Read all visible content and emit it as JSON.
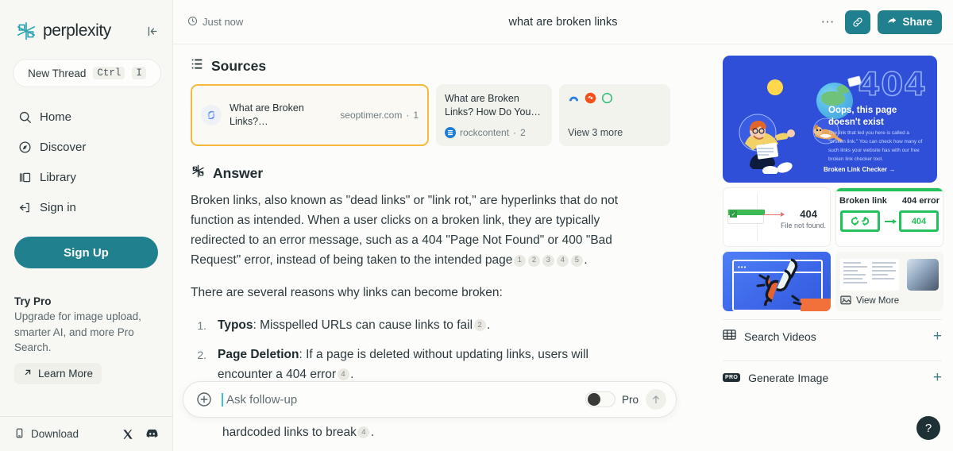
{
  "sidebar": {
    "brand": "perplexity",
    "collapse_icon": "collapse-sidebar-icon",
    "new_thread": {
      "label": "New Thread",
      "key1": "Ctrl",
      "key2": "I"
    },
    "nav": [
      {
        "label": "Home",
        "icon": "search-icon"
      },
      {
        "label": "Discover",
        "icon": "compass-icon"
      },
      {
        "label": "Library",
        "icon": "library-icon"
      },
      {
        "label": "Sign in",
        "icon": "signin-icon"
      }
    ],
    "signup_label": "Sign Up",
    "try_pro": {
      "title": "Try Pro",
      "description": "Upgrade for image upload, smarter AI, and more Pro Search.",
      "learn_more": "Learn More"
    },
    "footer": {
      "download": "Download",
      "x_icon": "x-twitter-icon",
      "discord_icon": "discord-icon"
    }
  },
  "topbar": {
    "timestamp": "Just now",
    "clock_icon": "clock-icon",
    "title": "what are broken links",
    "more_icon": "ellipsis-icon",
    "link_icon": "link-icon",
    "share_label": "Share",
    "share_icon": "share-arrow-icon"
  },
  "sources": {
    "heading": "Sources",
    "heading_icon": "sources-list-icon",
    "cards": [
      {
        "title": "What are Broken Links?…",
        "domain": "seoptimer.com",
        "index": "1",
        "favicon": "seoptimer-favicon",
        "highlighted": true,
        "highlight_color": "#f6b93b"
      },
      {
        "title": "What are Broken Links? How Do You…",
        "domain": "rockcontent",
        "index": "2",
        "favicon": "rockcontent-favicon",
        "highlighted": false
      }
    ],
    "more_card": {
      "label": "View 3 more",
      "favicons": [
        "ahrefs-favicon",
        "semrush-favicon",
        "circle-favicon"
      ]
    }
  },
  "answer": {
    "heading": "Answer",
    "heading_icon": "perplexity-mark-icon",
    "paragraph1_a": "Broken links, also known as \"dead links\" or \"link rot,\" are hyperlinks that do not function as intended. When a user clicks on a broken link, they are typically redirected to an error message, such as a 404 \"Page Not Found\" or 400 \"Bad Request\" error, instead of being taken to the intended page",
    "paragraph1_citations": [
      "1",
      "2",
      "3",
      "4",
      "5"
    ],
    "paragraph2": "There are several reasons why links can become broken:",
    "reasons": [
      {
        "num": "1.",
        "term": "Typos",
        "text": ": Misspelled URLs can cause links to fail",
        "citation": "2"
      },
      {
        "num": "2.",
        "term": "Page Deletion",
        "text": ": If a page is deleted without updating links, users will encounter a 404 error",
        "citation": "4"
      }
    ],
    "tail_text": "hardcoded links to break",
    "tail_citation": "4"
  },
  "followup": {
    "placeholder": "Ask follow-up",
    "value": "",
    "plus_icon": "plus-circle-icon",
    "pro_label": "Pro",
    "pro_enabled": false,
    "send_icon": "arrow-up-icon"
  },
  "media": {
    "hero": {
      "code": "404",
      "title": "Oops, this page doesn't exist",
      "description": "The link that led you here is called a \"broken link.\" You can check how many of such links your website has with our free broken link checker tool.",
      "cta": "Broken Link Checker →",
      "bg_color": "#2f4fd8"
    },
    "thumbnails": [
      {
        "name": "404-file-not-found-thumb",
        "code": "404",
        "caption": "File not found."
      },
      {
        "name": "broken-link-404-error-thumb",
        "left_label": "Broken link",
        "right_label": "404 error",
        "code": "404"
      },
      {
        "name": "broken-chain-browser-thumb"
      },
      {
        "name": "view-more-thumb",
        "label": "View More",
        "icon": "images-icon"
      }
    ],
    "actions": [
      {
        "label": "Search Videos",
        "icon": "video-grid-icon",
        "plus": "+"
      },
      {
        "label": "Generate Image",
        "icon": "pro-badge-icon",
        "badge": "PRO",
        "plus": "+"
      }
    ]
  },
  "help": {
    "label": "?"
  },
  "colors": {
    "accent_teal": "#20808d",
    "highlight": "#f6b93b",
    "hero_blue": "#2f4fd8",
    "green": "#21c25b"
  }
}
